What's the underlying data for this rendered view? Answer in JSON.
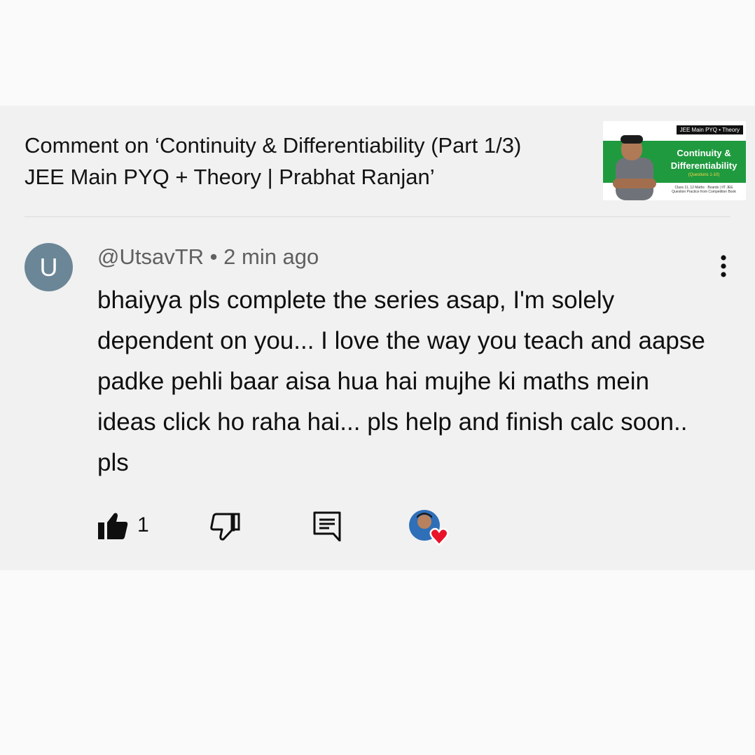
{
  "video": {
    "title_line1": "Comment on ‘Continuity & Differentiability (Part 1/3)",
    "title_line2": "JEE Main PYQ + Theory | Prabhat Ranjan’",
    "thumbnail": {
      "tag": "JEE Main PYQ • Theory",
      "title_line1": "Continuity &",
      "title_line2": "Differentiability",
      "subtitle": "(Questions 1-10)",
      "footer": "Class 11, 12 Maths · Boards | IIT JEE",
      "footer2": "Question Practice from Competition Book"
    }
  },
  "comment": {
    "avatar_letter": "U",
    "author": "@UtsavTR",
    "separator": " • ",
    "time": "2 min ago",
    "text": "bhaiyya pls complete the series asap, I'm solely dependent on you... I love the way you teach and aapse padke pehli baar aisa hua hai mujhe ki maths mein ideas click ho raha hai... pls help and finish calc soon.. pls",
    "like_count": "1"
  },
  "icons": {
    "menu": "more-vert-icon",
    "like": "thumb-up-icon",
    "dislike": "thumb-down-icon",
    "reply": "reply-icon",
    "heart": "creator-heart-icon"
  },
  "colors": {
    "card_bg": "#f1f1f1",
    "page_bg": "#fafafa",
    "avatar_bg": "#6b8697",
    "heart": "#e8132a",
    "thumbnail_green": "#1f9a3f"
  }
}
